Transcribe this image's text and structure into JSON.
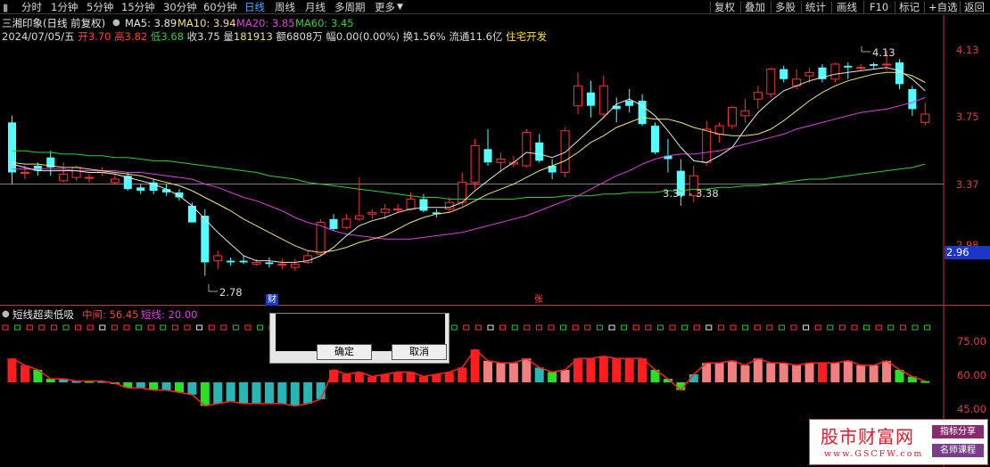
{
  "toolbar": {
    "left_items": [
      "分时",
      "1分钟",
      "5分钟",
      "15分钟",
      "30分钟",
      "60分钟",
      "日线",
      "周线",
      "月线",
      "多周期",
      "更多"
    ],
    "right_items": [
      "复权",
      "叠加",
      "多股",
      "统计",
      "画线",
      "F10",
      "标记",
      "+自选",
      "返回"
    ],
    "active": "日线",
    "left_marker": "▮"
  },
  "stock_title": "三湘印象(日线 前复权)",
  "ma": {
    "ma5": {
      "label": "MA5: 3.89",
      "color": "#e8e8e8"
    },
    "ma10": {
      "label": "MA10: 3.94",
      "color": "#f3e27a"
    },
    "ma20": {
      "label": "MA20: 3.85",
      "color": "#e040e0"
    },
    "ma60": {
      "label": "MA60: 3.45",
      "color": "#30d030"
    }
  },
  "quote": {
    "date": "2024/07/05/五",
    "open_label": "开",
    "open": "3.70",
    "high_label": "高",
    "high": "3.82",
    "low_label": "低",
    "low": "3.68",
    "close_label": "收",
    "close": "3.75",
    "vol_label": "量",
    "vol": "181913",
    "amount": "额6808万",
    "range": "幅0.00(0.00%)",
    "turnover": "换1.56%",
    "float": "流通11.6亿",
    "industry": "住宅开发"
  },
  "price_axis": {
    "ticks": [
      "4.13",
      "3.75",
      "3.37",
      "2.98"
    ],
    "current": "2.96"
  },
  "annotations": {
    "high": "4.13",
    "low": "2.78",
    "mid": "3.37 - 3.38",
    "cai": "财",
    "zhang": "张"
  },
  "indicator": {
    "name": "短线超卖低吸",
    "mid_label": "中间: 56.45",
    "short_label": "短线: 20.00",
    "axis_ticks": [
      "75.00",
      "60.00",
      "45.00"
    ]
  },
  "dialog": {
    "ok": "确定",
    "cancel": "取消"
  },
  "watermark": {
    "brand": "股市财富网",
    "url": "www.GSCFW.com",
    "tag1": "指标分享",
    "tag2": "名师课程"
  },
  "colors": {
    "up": "#ff3232",
    "down": "#54ffff",
    "bg": "#000000",
    "active_tab": "#49a8ff"
  },
  "chart_data": {
    "type": "candlestick",
    "ohlc": [
      [
        3.7,
        3.74,
        3.33,
        3.4
      ],
      [
        3.4,
        3.44,
        3.36,
        3.4
      ],
      [
        3.44,
        3.46,
        3.38,
        3.41
      ],
      [
        3.49,
        3.53,
        3.38,
        3.43
      ],
      [
        3.35,
        3.46,
        3.34,
        3.39
      ],
      [
        3.37,
        3.44,
        3.35,
        3.43
      ],
      [
        3.37,
        3.39,
        3.34,
        3.37
      ],
      [
        3.4,
        3.43,
        3.38,
        3.41
      ],
      [
        3.34,
        3.39,
        3.33,
        3.36
      ],
      [
        3.38,
        3.4,
        3.29,
        3.3
      ],
      [
        3.31,
        3.33,
        3.27,
        3.29
      ],
      [
        3.34,
        3.36,
        3.27,
        3.29
      ],
      [
        3.3,
        3.33,
        3.26,
        3.28
      ],
      [
        3.28,
        3.3,
        3.23,
        3.25
      ],
      [
        3.2,
        3.22,
        3.1,
        3.1
      ],
      [
        3.14,
        3.18,
        2.78,
        2.86
      ],
      [
        2.87,
        2.93,
        2.82,
        2.9
      ],
      [
        2.87,
        2.89,
        2.84,
        2.86
      ],
      [
        2.87,
        2.9,
        2.85,
        2.86
      ],
      [
        2.85,
        2.88,
        2.84,
        2.86
      ],
      [
        2.86,
        2.89,
        2.83,
        2.85
      ],
      [
        2.85,
        2.88,
        2.82,
        2.85
      ],
      [
        2.83,
        2.88,
        2.81,
        2.85
      ],
      [
        2.86,
        2.93,
        2.85,
        2.9
      ],
      [
        2.91,
        3.12,
        2.9,
        3.1
      ],
      [
        3.12,
        3.15,
        3.05,
        3.06
      ],
      [
        3.07,
        3.15,
        3.06,
        3.12
      ],
      [
        3.12,
        3.37,
        3.11,
        3.14
      ],
      [
        3.15,
        3.18,
        3.12,
        3.16
      ],
      [
        3.16,
        3.21,
        3.12,
        3.18
      ],
      [
        3.18,
        3.21,
        3.16,
        3.18
      ],
      [
        3.18,
        3.28,
        3.17,
        3.24
      ],
      [
        3.24,
        3.27,
        3.16,
        3.17
      ],
      [
        3.16,
        3.18,
        3.13,
        3.15
      ],
      [
        3.18,
        3.25,
        3.16,
        3.22
      ],
      [
        3.22,
        3.4,
        3.2,
        3.34
      ],
      [
        3.34,
        3.6,
        3.3,
        3.56
      ],
      [
        3.54,
        3.66,
        3.44,
        3.46
      ],
      [
        3.46,
        3.52,
        3.4,
        3.48
      ],
      [
        3.45,
        3.5,
        3.43,
        3.46
      ],
      [
        3.44,
        3.66,
        3.43,
        3.64
      ],
      [
        3.58,
        3.63,
        3.46,
        3.47
      ],
      [
        3.44,
        3.48,
        3.36,
        3.4
      ],
      [
        3.4,
        3.67,
        3.37,
        3.65
      ],
      [
        3.8,
        4.0,
        3.75,
        3.92
      ],
      [
        3.88,
        3.95,
        3.73,
        3.8
      ],
      [
        3.75,
        3.98,
        3.73,
        3.92
      ],
      [
        3.8,
        3.85,
        3.7,
        3.78
      ],
      [
        3.83,
        3.9,
        3.76,
        3.8
      ],
      [
        3.83,
        3.87,
        3.68,
        3.69
      ],
      [
        3.68,
        3.7,
        3.51,
        3.52
      ],
      [
        3.5,
        3.6,
        3.4,
        3.48
      ],
      [
        3.41,
        3.48,
        3.2,
        3.26
      ],
      [
        3.26,
        3.44,
        3.22,
        3.38
      ],
      [
        3.46,
        3.71,
        3.44,
        3.66
      ],
      [
        3.63,
        3.7,
        3.58,
        3.68
      ],
      [
        3.68,
        3.8,
        3.66,
        3.79
      ],
      [
        3.74,
        3.84,
        3.7,
        3.77
      ],
      [
        3.84,
        3.92,
        3.78,
        3.88
      ],
      [
        3.87,
        4.03,
        3.85,
        4.02
      ],
      [
        4.02,
        4.04,
        3.94,
        3.96
      ],
      [
        3.92,
        4.02,
        3.9,
        3.96
      ],
      [
        3.98,
        4.03,
        3.94,
        4.0
      ],
      [
        4.03,
        4.05,
        3.94,
        3.96
      ],
      [
        3.96,
        4.06,
        3.94,
        4.05
      ],
      [
        4.04,
        4.06,
        3.96,
        4.03
      ],
      [
        4.03,
        4.05,
        4.01,
        4.03
      ],
      [
        4.05,
        4.06,
        4.02,
        4.04
      ],
      [
        4.05,
        4.13,
        4.01,
        4.05
      ],
      [
        4.06,
        4.08,
        3.9,
        3.93
      ],
      [
        3.9,
        3.92,
        3.74,
        3.78
      ],
      [
        3.7,
        3.82,
        3.68,
        3.75
      ]
    ],
    "ma5": [
      3.45,
      3.43,
      3.41,
      3.41,
      3.41,
      3.41,
      3.4,
      3.4,
      3.39,
      3.37,
      3.35,
      3.33,
      3.3,
      3.26,
      3.2,
      3.12,
      3.04,
      2.97,
      2.9,
      2.87,
      2.87,
      2.86,
      2.86,
      2.87,
      2.9,
      2.95,
      3.02,
      3.08,
      3.11,
      3.13,
      3.16,
      3.18,
      3.19,
      3.19,
      3.19,
      3.22,
      3.29,
      3.35,
      3.41,
      3.46,
      3.52,
      3.51,
      3.49,
      3.52,
      3.59,
      3.66,
      3.73,
      3.81,
      3.84,
      3.8,
      3.74,
      3.65,
      3.55,
      3.47,
      3.46,
      3.5,
      3.55,
      3.66,
      3.76,
      3.83,
      3.89,
      3.92,
      3.95,
      3.97,
      3.99,
      4.0,
      4.01,
      4.02,
      4.03,
      4.01,
      3.96,
      3.89
    ],
    "ma10": [
      3.46,
      3.45,
      3.45,
      3.44,
      3.43,
      3.43,
      3.42,
      3.41,
      3.4,
      3.39,
      3.38,
      3.36,
      3.34,
      3.32,
      3.29,
      3.25,
      3.21,
      3.17,
      3.12,
      3.08,
      3.04,
      3.0,
      2.96,
      2.93,
      2.92,
      2.93,
      2.95,
      2.98,
      3.0,
      3.02,
      3.06,
      3.1,
      3.13,
      3.15,
      3.16,
      3.19,
      3.23,
      3.27,
      3.3,
      3.33,
      3.37,
      3.41,
      3.44,
      3.47,
      3.52,
      3.58,
      3.62,
      3.67,
      3.7,
      3.73,
      3.72,
      3.72,
      3.7,
      3.67,
      3.65,
      3.63,
      3.62,
      3.62,
      3.63,
      3.66,
      3.71,
      3.77,
      3.83,
      3.88,
      3.92,
      3.95,
      3.97,
      3.99,
      4.0,
      4.0,
      3.98,
      3.94
    ],
    "ma20": [
      3.42,
      3.42,
      3.42,
      3.42,
      3.42,
      3.41,
      3.41,
      3.41,
      3.41,
      3.4,
      3.4,
      3.39,
      3.38,
      3.37,
      3.36,
      3.33,
      3.31,
      3.28,
      3.25,
      3.23,
      3.2,
      3.17,
      3.13,
      3.1,
      3.08,
      3.05,
      3.03,
      3.02,
      3.01,
      3.0,
      3.0,
      3.0,
      3.01,
      3.02,
      3.03,
      3.04,
      3.06,
      3.08,
      3.1,
      3.12,
      3.14,
      3.17,
      3.2,
      3.23,
      3.26,
      3.3,
      3.34,
      3.38,
      3.41,
      3.45,
      3.48,
      3.5,
      3.51,
      3.51,
      3.52,
      3.53,
      3.55,
      3.57,
      3.59,
      3.61,
      3.63,
      3.66,
      3.68,
      3.7,
      3.72,
      3.74,
      3.76,
      3.77,
      3.78,
      3.8,
      3.82,
      3.85
    ],
    "ma60": [
      3.53,
      3.53,
      3.52,
      3.52,
      3.51,
      3.51,
      3.5,
      3.5,
      3.49,
      3.49,
      3.48,
      3.47,
      3.47,
      3.46,
      3.45,
      3.44,
      3.43,
      3.42,
      3.41,
      3.4,
      3.38,
      3.37,
      3.36,
      3.34,
      3.33,
      3.32,
      3.31,
      3.3,
      3.29,
      3.28,
      3.27,
      3.26,
      3.25,
      3.25,
      3.24,
      3.24,
      3.24,
      3.24,
      3.24,
      3.24,
      3.25,
      3.25,
      3.25,
      3.26,
      3.26,
      3.26,
      3.27,
      3.27,
      3.28,
      3.28,
      3.28,
      3.29,
      3.29,
      3.3,
      3.3,
      3.31,
      3.31,
      3.32,
      3.32,
      3.33,
      3.34,
      3.35,
      3.36,
      3.36,
      3.37,
      3.38,
      3.39,
      3.4,
      3.41,
      3.42,
      3.43,
      3.45
    ],
    "indicator_values": [
      67,
      64,
      62,
      58,
      58,
      57,
      57,
      57,
      56,
      54,
      54,
      53,
      53,
      52,
      51,
      46,
      47,
      48,
      47,
      47,
      47,
      47,
      46,
      47,
      49,
      62,
      60,
      61,
      59,
      60,
      61,
      61,
      59,
      60,
      61,
      63,
      71,
      66,
      65,
      65,
      67,
      63,
      61,
      62,
      67,
      67,
      68,
      67,
      67,
      67,
      62,
      58,
      53,
      60,
      65,
      65,
      66,
      64,
      67,
      65,
      65,
      64,
      65,
      65,
      65,
      66,
      64,
      64,
      66,
      62,
      59,
      57
    ],
    "indicator_colors": [
      "r",
      "r",
      "g",
      "g",
      "c",
      "c",
      "g",
      "c",
      "g",
      "g",
      "c",
      "g",
      "c",
      "g",
      "c",
      "g",
      "c",
      "c",
      "c",
      "c",
      "c",
      "c",
      "c",
      "c",
      "c",
      "r",
      "r",
      "r",
      "r",
      "r",
      "r",
      "r",
      "r",
      "r",
      "r",
      "r",
      "r",
      "p",
      "p",
      "p",
      "p",
      "c",
      "g",
      "p",
      "r",
      "r",
      "r",
      "r",
      "r",
      "r",
      "g",
      "g",
      "g",
      "c",
      "p",
      "p",
      "p",
      "p",
      "p",
      "p",
      "p",
      "p",
      "p",
      "r",
      "p",
      "p",
      "p",
      "p",
      "p",
      "g",
      "g",
      "g"
    ],
    "signal_row": [
      "r",
      "g",
      "r",
      "r",
      "r",
      "g",
      "r",
      "r",
      "w",
      "r",
      "r",
      "g",
      "r",
      "g",
      "r",
      "r",
      "w",
      "r",
      "r",
      "g",
      "r",
      "g",
      "w",
      "r",
      "g",
      "w",
      "r",
      "r",
      "g",
      "g",
      "r",
      "g",
      "r",
      "r",
      "g",
      "r",
      "r",
      "g",
      "r",
      "r",
      "w",
      "r",
      "g",
      "r",
      "r",
      "r",
      "g",
      "r",
      "r",
      "g",
      "w",
      "g",
      "r",
      "r",
      "g",
      "r",
      "g",
      "r",
      "w",
      "r",
      "r",
      "g",
      "r",
      "r",
      "g",
      "r",
      "w",
      "r",
      "g",
      "r",
      "r",
      "g",
      "r",
      "g",
      "r",
      "g",
      "g"
    ]
  }
}
